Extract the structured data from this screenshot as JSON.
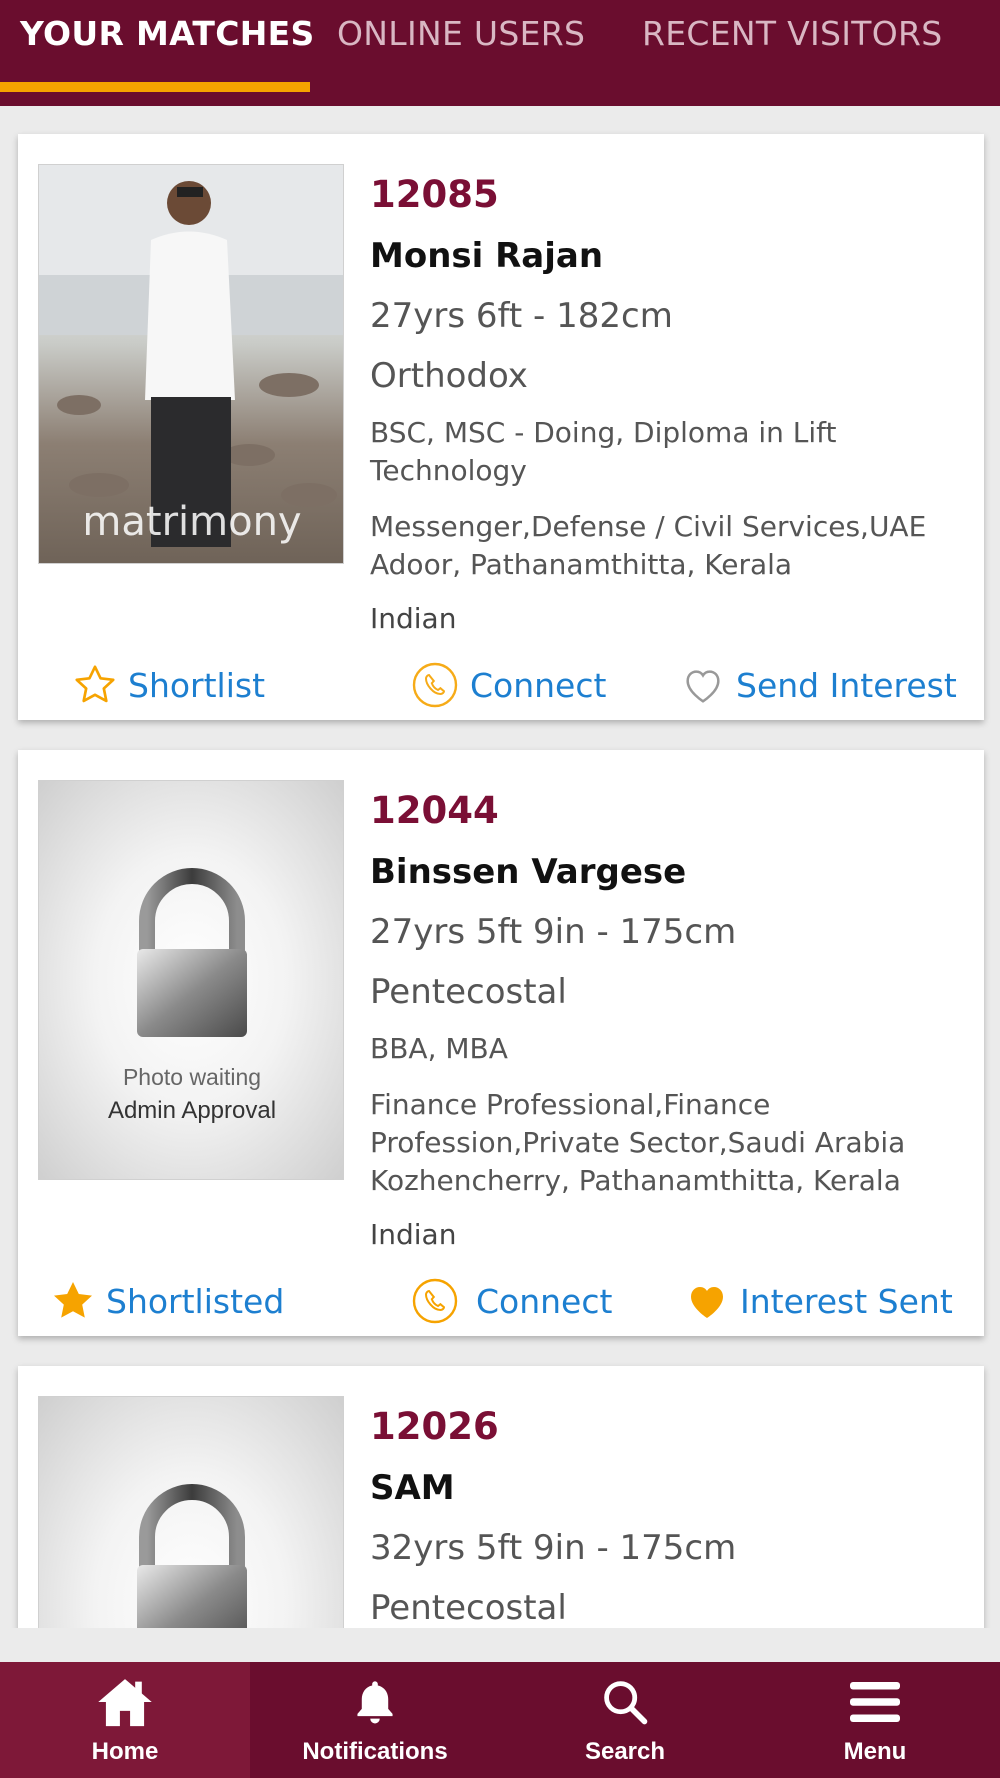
{
  "tabs": [
    {
      "label": "YOUR MATCHES",
      "active": true
    },
    {
      "label": "ONLINE USERS",
      "active": false
    },
    {
      "label": "RECENT VISITORS",
      "active": false
    }
  ],
  "profiles": [
    {
      "id": "12085",
      "name": "Monsi Rajan",
      "age_height": "27yrs 6ft - 182cm",
      "denomination": "Orthodox",
      "education": "BSC, MSC - Doing, Diploma in Lift Technology",
      "occupation": "Messenger,Defense / Civil Services,UAE",
      "location": "Adoor, Pathanamthitta, Kerala",
      "nationality": "Indian",
      "photo_watermark": "matrimony",
      "actions": {
        "shortlist": "Shortlist",
        "connect": "Connect",
        "interest": "Send Interest"
      },
      "shortlisted": false,
      "interest_sent": false
    },
    {
      "id": "12044",
      "name": "Binssen Vargese",
      "age_height": "27yrs 5ft 9in - 175cm",
      "denomination": "Pentecostal",
      "education": "BBA, MBA",
      "occupation": "Finance Professional,Finance Profession,Private Sector,Saudi Arabia",
      "location": "Kozhencherry, Pathanamthitta, Kerala",
      "nationality": "Indian",
      "photo_text_1": "Photo waiting",
      "photo_text_2": "Admin Approval",
      "actions": {
        "shortlist": "Shortlisted",
        "connect": "Connect",
        "interest": "Interest Sent"
      },
      "shortlisted": true,
      "interest_sent": true
    },
    {
      "id": "12026",
      "name": "SAM",
      "age_height": "32yrs 5ft 9in - 175cm",
      "denomination": "Pentecostal"
    }
  ],
  "bottom_nav": [
    {
      "label": "Home",
      "icon": "home-icon",
      "active": true
    },
    {
      "label": "Notifications",
      "icon": "bell-icon",
      "active": false
    },
    {
      "label": "Search",
      "icon": "search-icon",
      "active": false
    },
    {
      "label": "Menu",
      "icon": "menu-icon",
      "active": false
    }
  ],
  "colors": {
    "brand": "#6a0d2e",
    "accent": "#f6a300",
    "link": "#1d7fd0",
    "id": "#7a0f35"
  }
}
